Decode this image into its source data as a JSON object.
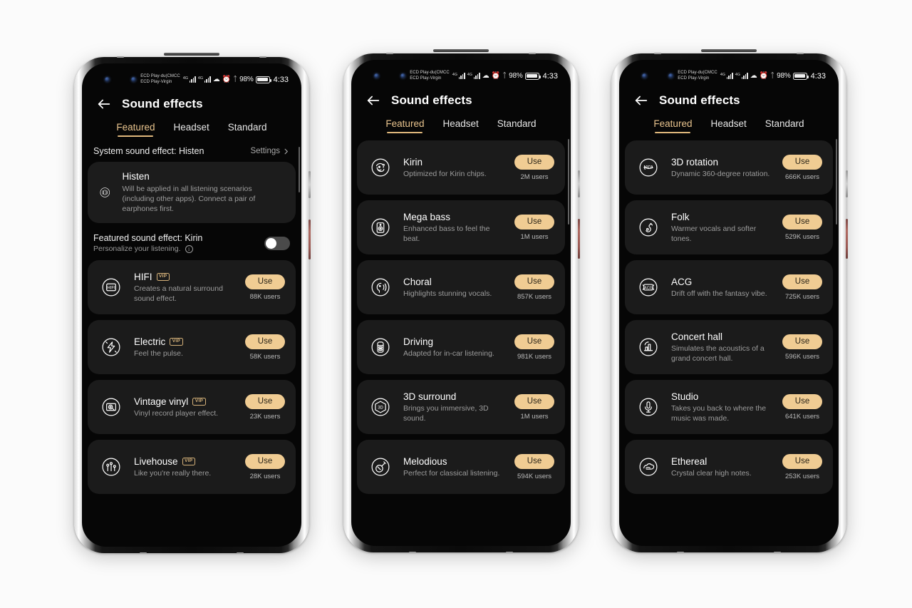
{
  "app": {
    "title": "Sound effects",
    "back_icon": "back-arrow-icon",
    "tabs": [
      {
        "label": "Featured",
        "active": true
      },
      {
        "label": "Headset",
        "active": false
      },
      {
        "label": "Standard",
        "active": false
      }
    ]
  },
  "status_bar": {
    "carrier_line1": "ECD Play-du(CMCC",
    "carrier_line2": "ECD Play-Virgin",
    "network_type_1": "4G",
    "network_type_2": "4G",
    "wifi_icon": "wifi-icon",
    "alarm_icon": "alarm-clock-icon",
    "bluetooth_icon": "bluetooth-icon",
    "battery_percent": "98%",
    "time": "4:33"
  },
  "colors": {
    "accent": "#e0b87c",
    "use_button_bg": "#f0cc93",
    "use_button_text": "#2a2418",
    "card_bg": "#1b1b1b",
    "screen_bg": "#060606",
    "vip_badge": "#d6b27a"
  },
  "phone1": {
    "system_effect_label": "System sound effect: Histen",
    "settings_label": "Settings",
    "settings_chevron": "chevron-right-icon",
    "banner": {
      "icon": "histen-waveform-icon",
      "title": "Histen",
      "description": "Will be applied in all listening scenarios (including other apps). Connect a pair of earphones first."
    },
    "featured_toggle": {
      "label": "Featured sound effect: Kirin",
      "sublabel": "Personalize your listening.",
      "info_icon": "info-icon",
      "enabled": false
    },
    "items": [
      {
        "icon": "hifi-icon",
        "title": "HIFI",
        "vip": "VIP",
        "desc": "Creates a natural surround sound effect.",
        "button": "Use",
        "users": "88K users"
      },
      {
        "icon": "electric-bolt-icon",
        "title": "Electric",
        "vip": "VIP",
        "desc": "Feel the pulse.",
        "button": "Use",
        "users": "58K users"
      },
      {
        "icon": "vinyl-record-icon",
        "title": "Vintage vinyl",
        "vip": "VIP",
        "desc": "Vinyl record player effect.",
        "button": "Use",
        "users": "23K users"
      },
      {
        "icon": "livehouse-icon",
        "title": "Livehouse",
        "vip": "VIP",
        "desc": "Like you're really there.",
        "button": "Use",
        "users": "28K users"
      }
    ]
  },
  "phone2": {
    "items": [
      {
        "icon": "kirin-lion-icon",
        "title": "Kirin",
        "vip": "",
        "desc": "Optimized for Kirin chips.",
        "button": "Use",
        "users": "2M users"
      },
      {
        "icon": "speaker-bass-icon",
        "title": "Mega bass",
        "vip": "",
        "desc": "Enhanced bass to feel the beat.",
        "button": "Use",
        "users": "1M users"
      },
      {
        "icon": "choral-voice-icon",
        "title": "Choral",
        "vip": "",
        "desc": "Highlights stunning vocals.",
        "button": "Use",
        "users": "857K users"
      },
      {
        "icon": "car-driving-icon",
        "title": "Driving",
        "vip": "",
        "desc": "Adapted for in-car listening.",
        "button": "Use",
        "users": "981K users"
      },
      {
        "icon": "3d-surround-icon",
        "title": "3D surround",
        "vip": "",
        "desc": "Brings you immersive, 3D sound.",
        "button": "Use",
        "users": "1M users"
      },
      {
        "icon": "violin-icon",
        "title": "Melodious",
        "vip": "",
        "desc": "Perfect for classical listening.",
        "button": "Use",
        "users": "594K users"
      }
    ]
  },
  "phone3": {
    "items": [
      {
        "icon": "3d-rotation-icon",
        "title": "3D rotation",
        "vip": "",
        "desc": "Dynamic 360-degree rotation.",
        "button": "Use",
        "users": "666K users"
      },
      {
        "icon": "guitar-icon",
        "title": "Folk",
        "vip": "",
        "desc": "Warmer vocals and softer tones.",
        "button": "Use",
        "users": "529K users"
      },
      {
        "icon": "acg-icon",
        "title": "ACG",
        "vip": "",
        "desc": "Drift off with the fantasy vibe.",
        "button": "Use",
        "users": "725K users"
      },
      {
        "icon": "concert-hall-icon",
        "title": "Concert hall",
        "vip": "",
        "desc": "Simulates the acoustics of a grand concert hall.",
        "button": "Use",
        "users": "596K users"
      },
      {
        "icon": "microphone-icon",
        "title": "Studio",
        "vip": "",
        "desc": "Takes you back to where the music was made.",
        "button": "Use",
        "users": "641K users"
      },
      {
        "icon": "ethereal-cloud-icon",
        "title": "Ethereal",
        "vip": "",
        "desc": "Crystal clear high notes.",
        "button": "Use",
        "users": "253K users"
      }
    ]
  }
}
